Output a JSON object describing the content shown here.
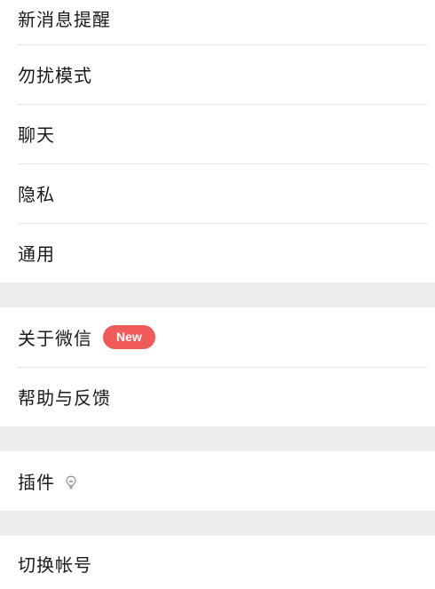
{
  "settings": {
    "group1": [
      {
        "label": "新消息提醒"
      },
      {
        "label": "勿扰模式"
      },
      {
        "label": "聊天"
      },
      {
        "label": "隐私"
      },
      {
        "label": "通用"
      }
    ],
    "group2": [
      {
        "label": "关于微信",
        "badge": "New"
      },
      {
        "label": "帮助与反馈"
      }
    ],
    "group3": [
      {
        "label": "插件",
        "icon": "lightbulb-icon"
      }
    ],
    "group4": [
      {
        "label": "切换帐号"
      }
    ]
  },
  "colors": {
    "badge": "#f05a5a",
    "divider": "#e6e6e6",
    "gap": "#eeeeee"
  }
}
